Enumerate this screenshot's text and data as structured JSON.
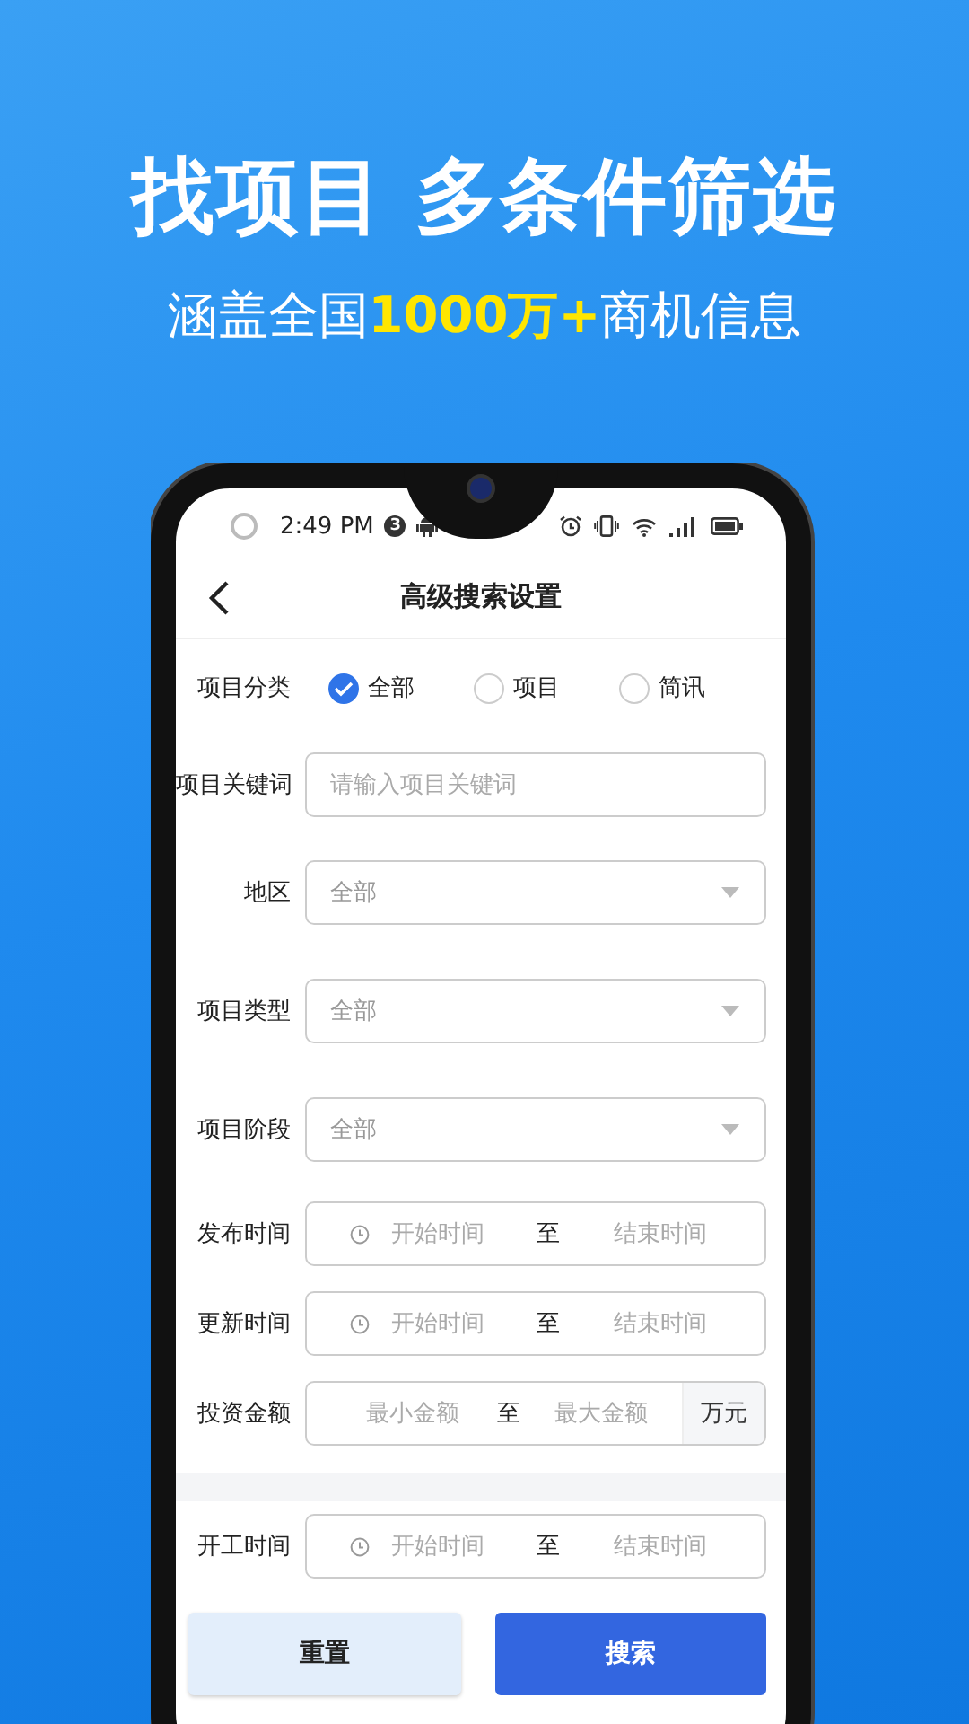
{
  "promo": {
    "headline": "找项目 多条件筛选",
    "subtitle": {
      "before": "涵盖全国",
      "highlight": "1000万+",
      "after": "商机信息"
    }
  },
  "status_bar": {
    "time": "2:49 PM",
    "notification_count": "3"
  },
  "nav": {
    "title": "高级搜索设置"
  },
  "form": {
    "sections": [
      {
        "rows": [
          {
            "kind": "radio",
            "label": "项目分类",
            "options": [
              {
                "label": "全部",
                "selected": true
              },
              {
                "label": "项目",
                "selected": false
              },
              {
                "label": "简讯",
                "selected": false
              }
            ]
          },
          {
            "kind": "text",
            "label": "项目关键词",
            "placeholder": "请输入项目关键词"
          },
          {
            "kind": "select",
            "label": "地区",
            "value": "全部"
          },
          {
            "kind": "select",
            "label": "项目类型",
            "value": "全部"
          },
          {
            "kind": "select",
            "label": "项目阶段",
            "value": "全部"
          },
          {
            "kind": "date_range",
            "label": "发布时间",
            "start_placeholder": "开始时间",
            "separator": "至",
            "end_placeholder": "结束时间"
          },
          {
            "kind": "date_range",
            "label": "更新时间",
            "start_placeholder": "开始时间",
            "separator": "至",
            "end_placeholder": "结束时间"
          },
          {
            "kind": "amount_range",
            "label": "投资金额",
            "min_placeholder": "最小金额",
            "separator": "至",
            "max_placeholder": "最大金额",
            "unit": "万元"
          }
        ]
      },
      {
        "rows": [
          {
            "kind": "date_range",
            "label": "开工时间",
            "start_placeholder": "开始时间",
            "separator": "至",
            "end_placeholder": "结束时间"
          }
        ]
      }
    ]
  },
  "buttons": [
    {
      "kind": "secondary",
      "label": "重置"
    },
    {
      "kind": "primary",
      "label": "搜索"
    }
  ]
}
